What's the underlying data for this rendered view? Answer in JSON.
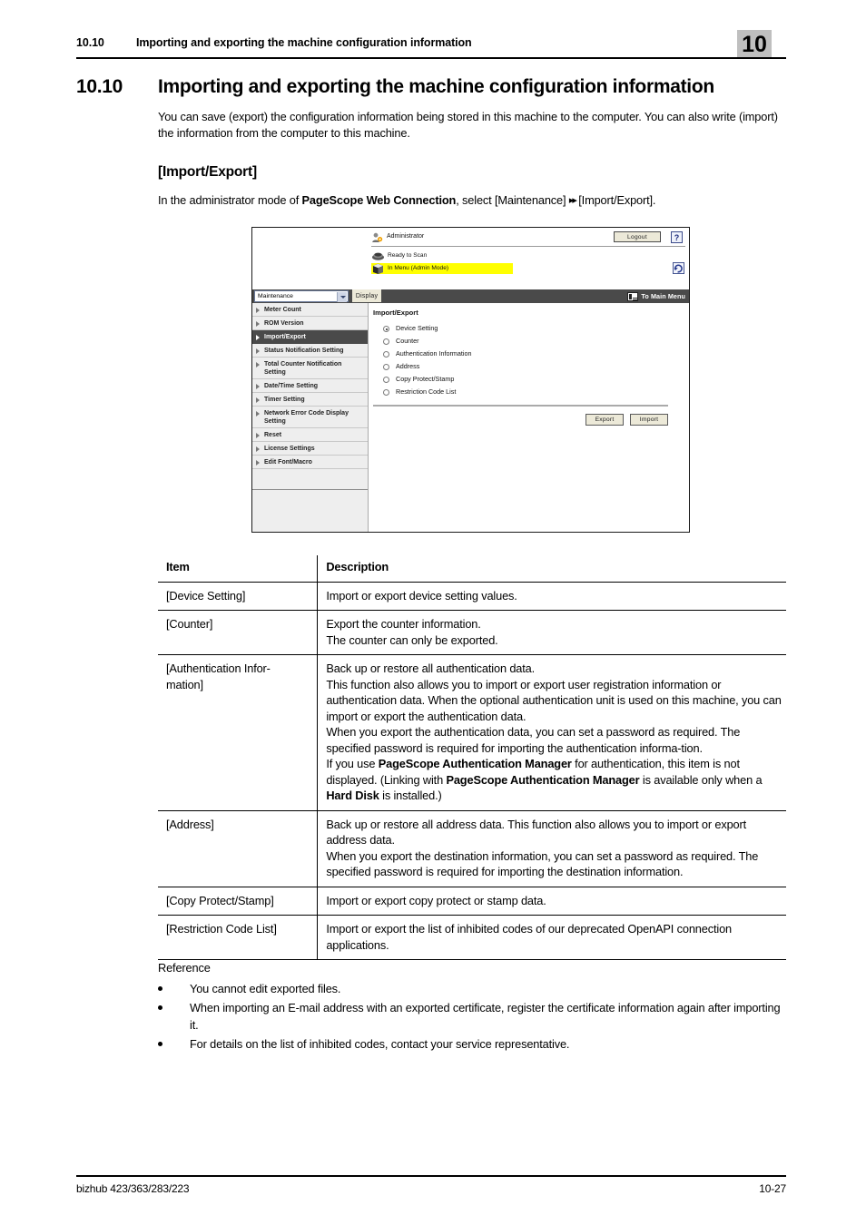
{
  "header": {
    "section_number": "10.10",
    "running_title": "Importing and exporting the machine configuration information",
    "chapter_number": "10"
  },
  "section": {
    "number": "10.10",
    "title": "Importing and exporting the machine configuration information",
    "intro": "You can save (export) the configuration information being stored in this machine to the computer. You can also write (import) the information from the computer to this machine.",
    "subheading": "[Import/Export]",
    "path_prefix": "In the administrator mode of ",
    "path_bold": "PageScope Web Connection",
    "path_mid": ", select [Maintenance] ",
    "path_arrows": "▸▸",
    "path_suffix": " [Import/Export]."
  },
  "screenshot": {
    "admin_label": "Administrator",
    "logout_label": "Logout",
    "help_label": "?",
    "status_ready": "Ready to Scan",
    "status_menu": "In Menu (Admin Mode)",
    "dropdown_value": "Maintenance",
    "display_button": "Display",
    "to_main_menu": "To Main Menu",
    "highlight_color": "#ffff00",
    "active_item_color": "#4a4a4a",
    "sidebar": [
      {
        "label": "Meter Count",
        "active": false
      },
      {
        "label": "ROM Version",
        "active": false
      },
      {
        "label": "Import/Export",
        "active": true
      },
      {
        "label": "Status Notification Setting",
        "active": false
      },
      {
        "label": "Total Counter Notification Setting",
        "active": false
      },
      {
        "label": "Date/Time Setting",
        "active": false
      },
      {
        "label": "Timer Setting",
        "active": false
      },
      {
        "label": "Network Error Code Display Setting",
        "active": false
      },
      {
        "label": "Reset",
        "active": false
      },
      {
        "label": "License Settings",
        "active": false
      },
      {
        "label": "Edit Font/Macro",
        "active": false
      }
    ],
    "content_title": "Import/Export",
    "radio_options": [
      {
        "label": "Device Setting",
        "checked": true
      },
      {
        "label": "Counter",
        "checked": false
      },
      {
        "label": "Authentication Information",
        "checked": false
      },
      {
        "label": "Address",
        "checked": false
      },
      {
        "label": "Copy Protect/Stamp",
        "checked": false
      },
      {
        "label": "Restriction Code List",
        "checked": false
      }
    ],
    "export_button": "Export",
    "import_button": "Import"
  },
  "table": {
    "headers": [
      "Item",
      "Description"
    ],
    "rows": [
      {
        "item": "[Device Setting]",
        "description": "Import or export device setting values."
      },
      {
        "item": "[Counter]",
        "description": "Export the counter information.\nThe counter can only be exported."
      },
      {
        "item": "[Authentication Information]",
        "description": "Back up or restore all authentication data.\nThis function also allows you to import or export user registration information or authentication data. When the optional authentication unit is used on this machine, you can import or export the authentication data.\nWhen you export the authentication data, you can set a password as required. The specified password is required for importing the authentication information.\nIf you use PageScope Authentication Manager for authentication, this item is not displayed. (Linking with PageScope Authentication Manager is available only when a Hard Disk is installed.)"
      },
      {
        "item": "[Address]",
        "description": "Back up or restore all address data. This function also allows you to import or export address data.\nWhen you export the destination information, you can set a password as required. The specified password is required for importing the destination information."
      },
      {
        "item": "[Copy Protect/Stamp]",
        "description": "Import or export copy protect or stamp data."
      },
      {
        "item": "[Restriction Code List]",
        "description": "Import or export the list of inhibited codes of our deprecated OpenAPI connection applications."
      }
    ]
  },
  "reference": {
    "heading": "Reference",
    "items": [
      "You cannot edit exported files.",
      "When importing an E-mail address with an exported certificate, register the certificate information again after importing it.",
      "For details on the list of inhibited codes, contact your service representative."
    ]
  },
  "footer": {
    "left": "bizhub 423/363/283/223",
    "right": "10-27"
  }
}
